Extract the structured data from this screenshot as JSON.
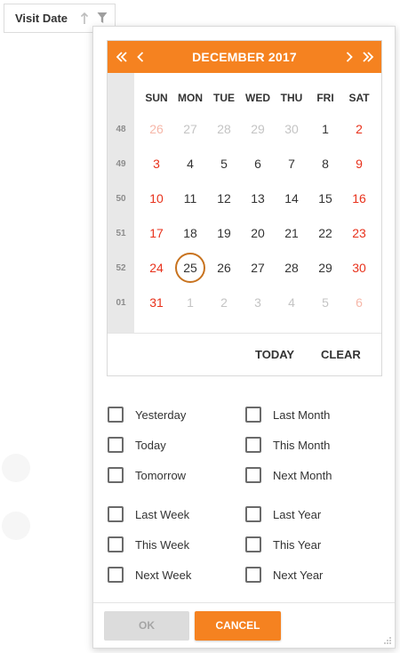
{
  "column_header": {
    "title": "Visit Date",
    "sort_icon": "arrow-up-icon",
    "filter_icon": "funnel-icon"
  },
  "calendar": {
    "title": "DECEMBER 2017",
    "nav": {
      "prev_year_icon": "double-chevron-left-icon",
      "prev_month_icon": "chevron-left-icon",
      "next_month_icon": "chevron-right-icon",
      "next_year_icon": "double-chevron-right-icon"
    },
    "days_of_week": [
      "SUN",
      "MON",
      "TUE",
      "WED",
      "THU",
      "FRI",
      "SAT"
    ],
    "weeks": [
      {
        "number": "48",
        "days": [
          "26",
          "27",
          "28",
          "29",
          "30",
          "1",
          "2"
        ]
      },
      {
        "number": "49",
        "days": [
          "3",
          "4",
          "5",
          "6",
          "7",
          "8",
          "9"
        ]
      },
      {
        "number": "50",
        "days": [
          "10",
          "11",
          "12",
          "13",
          "14",
          "15",
          "16"
        ]
      },
      {
        "number": "51",
        "days": [
          "17",
          "18",
          "19",
          "20",
          "21",
          "22",
          "23"
        ]
      },
      {
        "number": "52",
        "days": [
          "24",
          "25",
          "26",
          "27",
          "28",
          "29",
          "30"
        ]
      },
      {
        "number": "01",
        "days": [
          "31",
          "1",
          "2",
          "3",
          "4",
          "5",
          "6"
        ]
      }
    ],
    "selected_day": "25",
    "today_label": "TODAY",
    "clear_label": "CLEAR",
    "colors": {
      "header": "#f58220",
      "weekend": "#e8321c",
      "selected_ring": "#c8731f"
    }
  },
  "quick_options": {
    "left": [
      "Yesterday",
      "Today",
      "Tomorrow",
      "Last Week",
      "This Week",
      "Next Week"
    ],
    "right": [
      "Last Month",
      "This Month",
      "Next Month",
      "Last Year",
      "This Year",
      "Next Year"
    ]
  },
  "footer": {
    "ok_label": "OK",
    "cancel_label": "CANCEL"
  }
}
